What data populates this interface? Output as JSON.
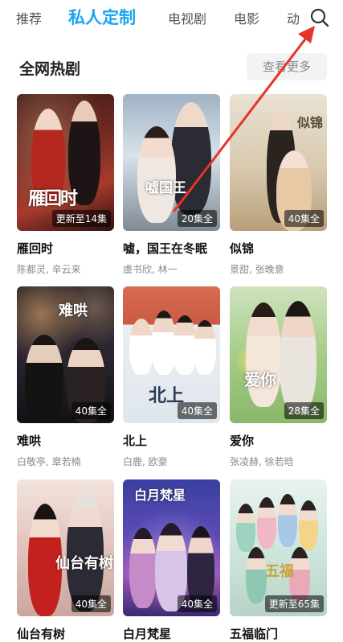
{
  "tabs": [
    {
      "label": "推荐"
    },
    {
      "label": "私人定制"
    },
    {
      "label": "电视剧"
    },
    {
      "label": "电影"
    },
    {
      "label": "动"
    }
  ],
  "section": {
    "title": "全网热剧",
    "more_label": "查看更多"
  },
  "shows": [
    {
      "title": "雁回时",
      "cast": "陈都灵, 辛云来",
      "badge": "更新至14集",
      "poster_text": "雁回时"
    },
    {
      "title": "嘘，国王在冬眠",
      "cast": "虞书欣, 林一",
      "badge": "20集全",
      "poster_text": "嘘国王"
    },
    {
      "title": "似锦",
      "cast": "景甜, 张晚意",
      "badge": "40集全",
      "poster_text": "似锦"
    },
    {
      "title": "难哄",
      "cast": "白敬亭, 章若楠",
      "badge": "40集全",
      "poster_text": "难哄"
    },
    {
      "title": "北上",
      "cast": "白鹿, 欧豪",
      "badge": "40集全",
      "poster_text": "北上"
    },
    {
      "title": "爱你",
      "cast": "张凌赫, 徐若晗",
      "badge": "28集全",
      "poster_text": "爱你"
    },
    {
      "title": "仙台有树",
      "cast": "",
      "badge": "40集全",
      "poster_text": "仙台有树"
    },
    {
      "title": "白月梵星",
      "cast": "",
      "badge": "40集全",
      "poster_text": "白月梵星"
    },
    {
      "title": "五福临门",
      "cast": "",
      "badge": "更新至65集",
      "poster_text": "五福"
    }
  ],
  "icons": {
    "search": "search-icon"
  },
  "colors": {
    "accent": "#1aa3ee",
    "annotation_arrow": "#e8322a"
  }
}
